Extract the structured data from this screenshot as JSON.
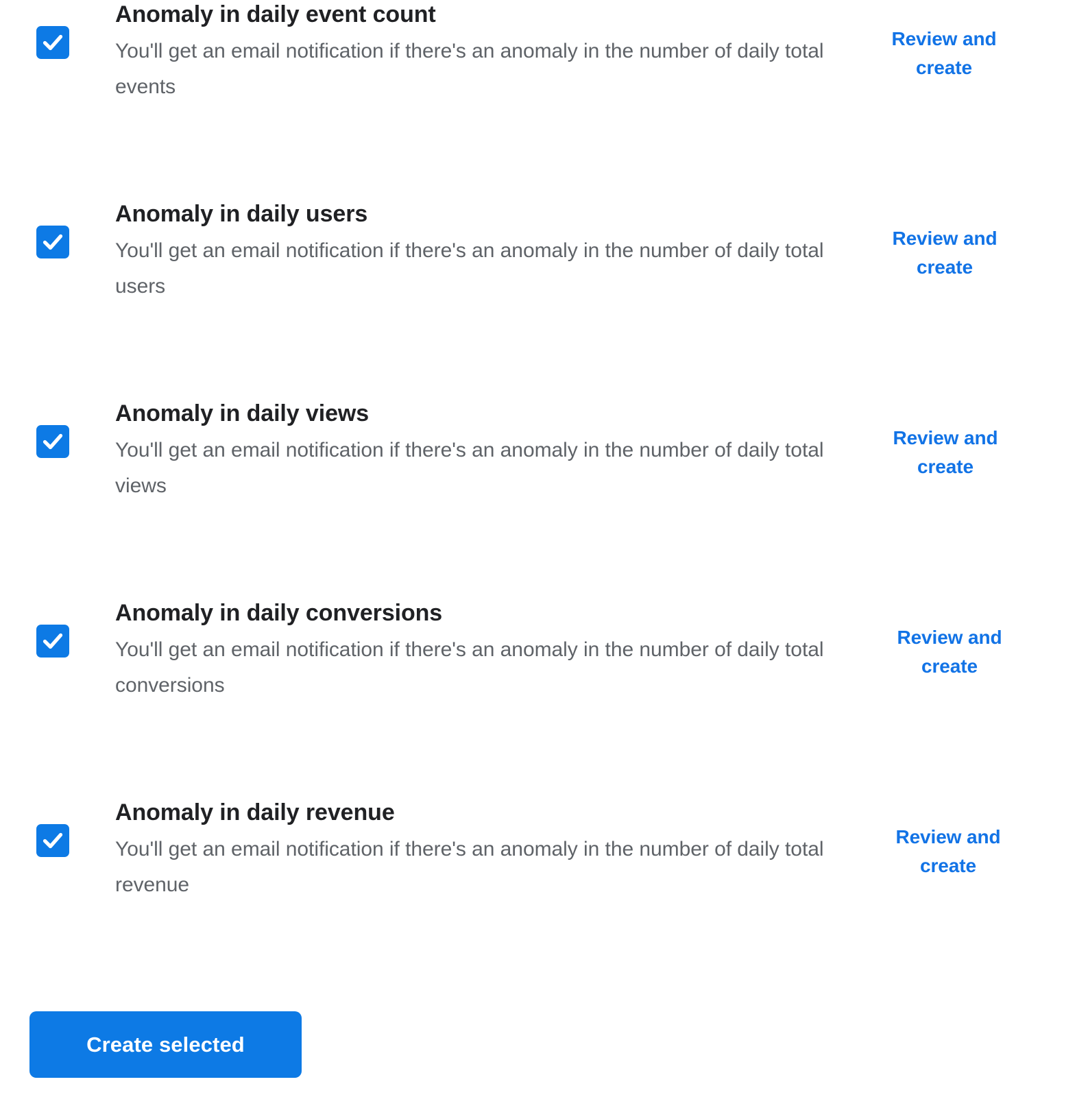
{
  "theme": {
    "accent_blue": "#0d7ae5",
    "link_blue": "#1273e6",
    "title_color": "#202124",
    "description_color": "#5f6368",
    "background": "#ffffff"
  },
  "alerts": [
    {
      "title": "Anomaly in daily event count",
      "description": "You'll get an email notification if there's an anomaly in the number of daily total events",
      "action_label": "Review and create",
      "checked": true,
      "checkbox_icon": "checkmark-icon"
    },
    {
      "title": "Anomaly in daily users",
      "description": "You'll get an email notification if there's an anomaly in the number of daily total users",
      "action_label": "Review and create",
      "checked": true,
      "checkbox_icon": "checkmark-icon"
    },
    {
      "title": "Anomaly in daily views",
      "description": "You'll get an email notification if there's an anomaly in the number of daily total views",
      "action_label": "Review and create",
      "checked": true,
      "checkbox_icon": "checkmark-icon"
    },
    {
      "title": "Anomaly in daily conversions",
      "description": "You'll get an email notification if there's an anomaly in the number of daily total conversions",
      "action_label": "Review and create",
      "checked": true,
      "checkbox_icon": "checkmark-icon"
    },
    {
      "title": "Anomaly in daily revenue",
      "description": "You'll get an email notification if there's an anomaly in the number of daily total revenue",
      "action_label": "Review and create",
      "checked": true,
      "checkbox_icon": "checkmark-icon"
    }
  ],
  "footer": {
    "create_selected_label": "Create selected"
  }
}
